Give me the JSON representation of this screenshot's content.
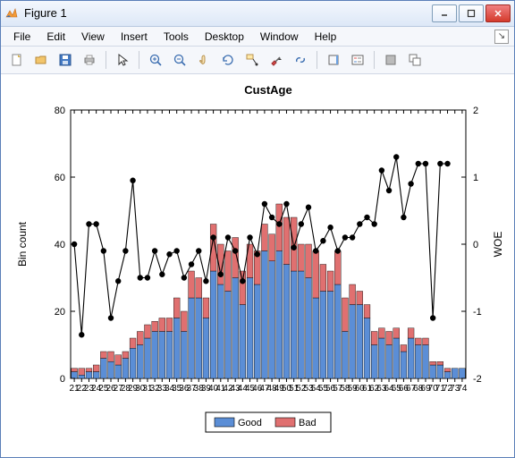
{
  "window": {
    "title": "Figure 1"
  },
  "menu": {
    "items": [
      "File",
      "Edit",
      "View",
      "Insert",
      "Tools",
      "Desktop",
      "Window",
      "Help"
    ]
  },
  "chart_data": {
    "type": "bar",
    "title": "CustAge",
    "xlabel": "",
    "ylabel": "Bin count",
    "y2label": "WOE",
    "ylim": [
      0,
      80
    ],
    "y2lim": [
      -2,
      2
    ],
    "yticks": [
      0,
      20,
      40,
      60,
      80
    ],
    "y2ticks": [
      -2,
      -1,
      0,
      1,
      2
    ],
    "categories": [
      21,
      22,
      23,
      24,
      25,
      26,
      27,
      28,
      29,
      30,
      31,
      32,
      33,
      34,
      35,
      36,
      37,
      38,
      39,
      40,
      41,
      42,
      43,
      44,
      45,
      46,
      47,
      48,
      49,
      50,
      51,
      52,
      53,
      54,
      55,
      56,
      57,
      58,
      59,
      60,
      61,
      62,
      63,
      64,
      65,
      66,
      67,
      68,
      69,
      70,
      71,
      72,
      73,
      74
    ],
    "series": [
      {
        "name": "Good",
        "color": "#5b8ed6",
        "values": [
          2,
          1,
          2,
          2,
          6,
          5,
          4,
          6,
          9,
          10,
          12,
          14,
          14,
          14,
          18,
          14,
          24,
          24,
          18,
          32,
          28,
          26,
          30,
          22,
          30,
          28,
          38,
          35,
          38,
          34,
          32,
          32,
          30,
          24,
          26,
          26,
          28,
          14,
          22,
          22,
          18,
          10,
          12,
          10,
          12,
          8,
          12,
          10,
          10,
          4,
          4,
          2,
          3,
          3
        ]
      },
      {
        "name": "Bad",
        "color": "#e07070",
        "values": [
          1,
          2,
          1,
          2,
          2,
          3,
          3,
          2,
          3,
          4,
          4,
          3,
          4,
          4,
          6,
          6,
          8,
          6,
          6,
          14,
          12,
          12,
          12,
          10,
          10,
          10,
          8,
          8,
          14,
          14,
          16,
          8,
          10,
          14,
          8,
          6,
          10,
          10,
          6,
          4,
          4,
          4,
          3,
          4,
          3,
          2,
          3,
          2,
          2,
          1,
          1,
          1,
          0,
          0
        ]
      },
      {
        "name": "WOE",
        "type": "line",
        "axis": "y2",
        "color": "#000",
        "marker": "o",
        "values": [
          0,
          -1.35,
          0.3,
          0.3,
          -0.1,
          -1.1,
          -0.55,
          -0.1,
          0.95,
          -0.5,
          -0.5,
          -0.1,
          -0.45,
          -0.15,
          -0.1,
          -0.5,
          -0.3,
          -0.1,
          -0.55,
          0.1,
          -0.45,
          0.1,
          -0.1,
          -0.55,
          0.1,
          -0.15,
          0.6,
          0.4,
          0.3,
          0.6,
          -0.05,
          0.3,
          0.55,
          -0.1,
          0.05,
          0.25,
          -0.1,
          0.1,
          0.1,
          0.3,
          0.4,
          0.3,
          1.1,
          0.8,
          1.3,
          0.4,
          0.9,
          1.2,
          1.2,
          -1.1,
          1.2,
          1.2,
          null,
          null
        ]
      }
    ],
    "legend": [
      "Good",
      "Bad"
    ]
  }
}
